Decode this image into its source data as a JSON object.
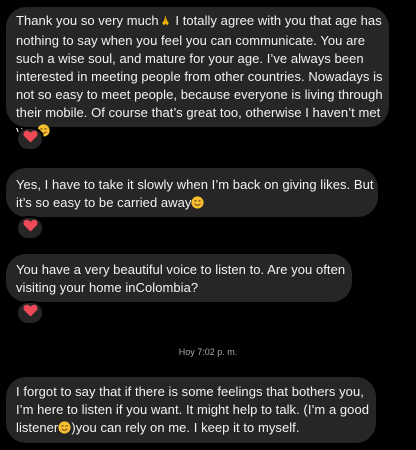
{
  "messages": [
    {
      "lines": [
        "Thank you so very much",
        " I totally agree with you that age has",
        "nothing to say when you feel you can communicate. You are",
        "such a wise soul, and mature for your age. I’ve always been",
        "interested in meeting people from other countries. Nowadays is",
        "not so easy to meet people, because everyone is living through",
        "their mobile. Of course that’s great too, otherwise I haven’t met",
        "you"
      ],
      "reaction": "red-heart"
    },
    {
      "lines": [
        "Yes, I have to take it slowly when I’m back on giving likes. But",
        "it’s so easy to be carried away"
      ],
      "reaction": "red-heart"
    },
    {
      "lines": [
        "You have a very beautiful voice to listen to. Are you often",
        "visiting your home inColombia?"
      ],
      "reaction": "red-heart"
    },
    {
      "lines": [
        "I forgot to say that if there is some feelings that bothers you,",
        "I’m here to listen if you want. It might help to talk. (I’m a good",
        "listener",
        ")you can rely on me. I keep it to myself."
      ]
    }
  ],
  "timestamp": "Hoy 7:02 p. m.",
  "icons": {
    "praying_hands": "praying-hands-emoji",
    "smiling_face": "smiling-face-emoji",
    "heart": "red-heart-icon"
  },
  "colors": {
    "background": "#000000",
    "bubble": "#262626",
    "text": "#f2f2f2",
    "timestamp": "#a8a8a8",
    "heart": "#ed4956"
  }
}
